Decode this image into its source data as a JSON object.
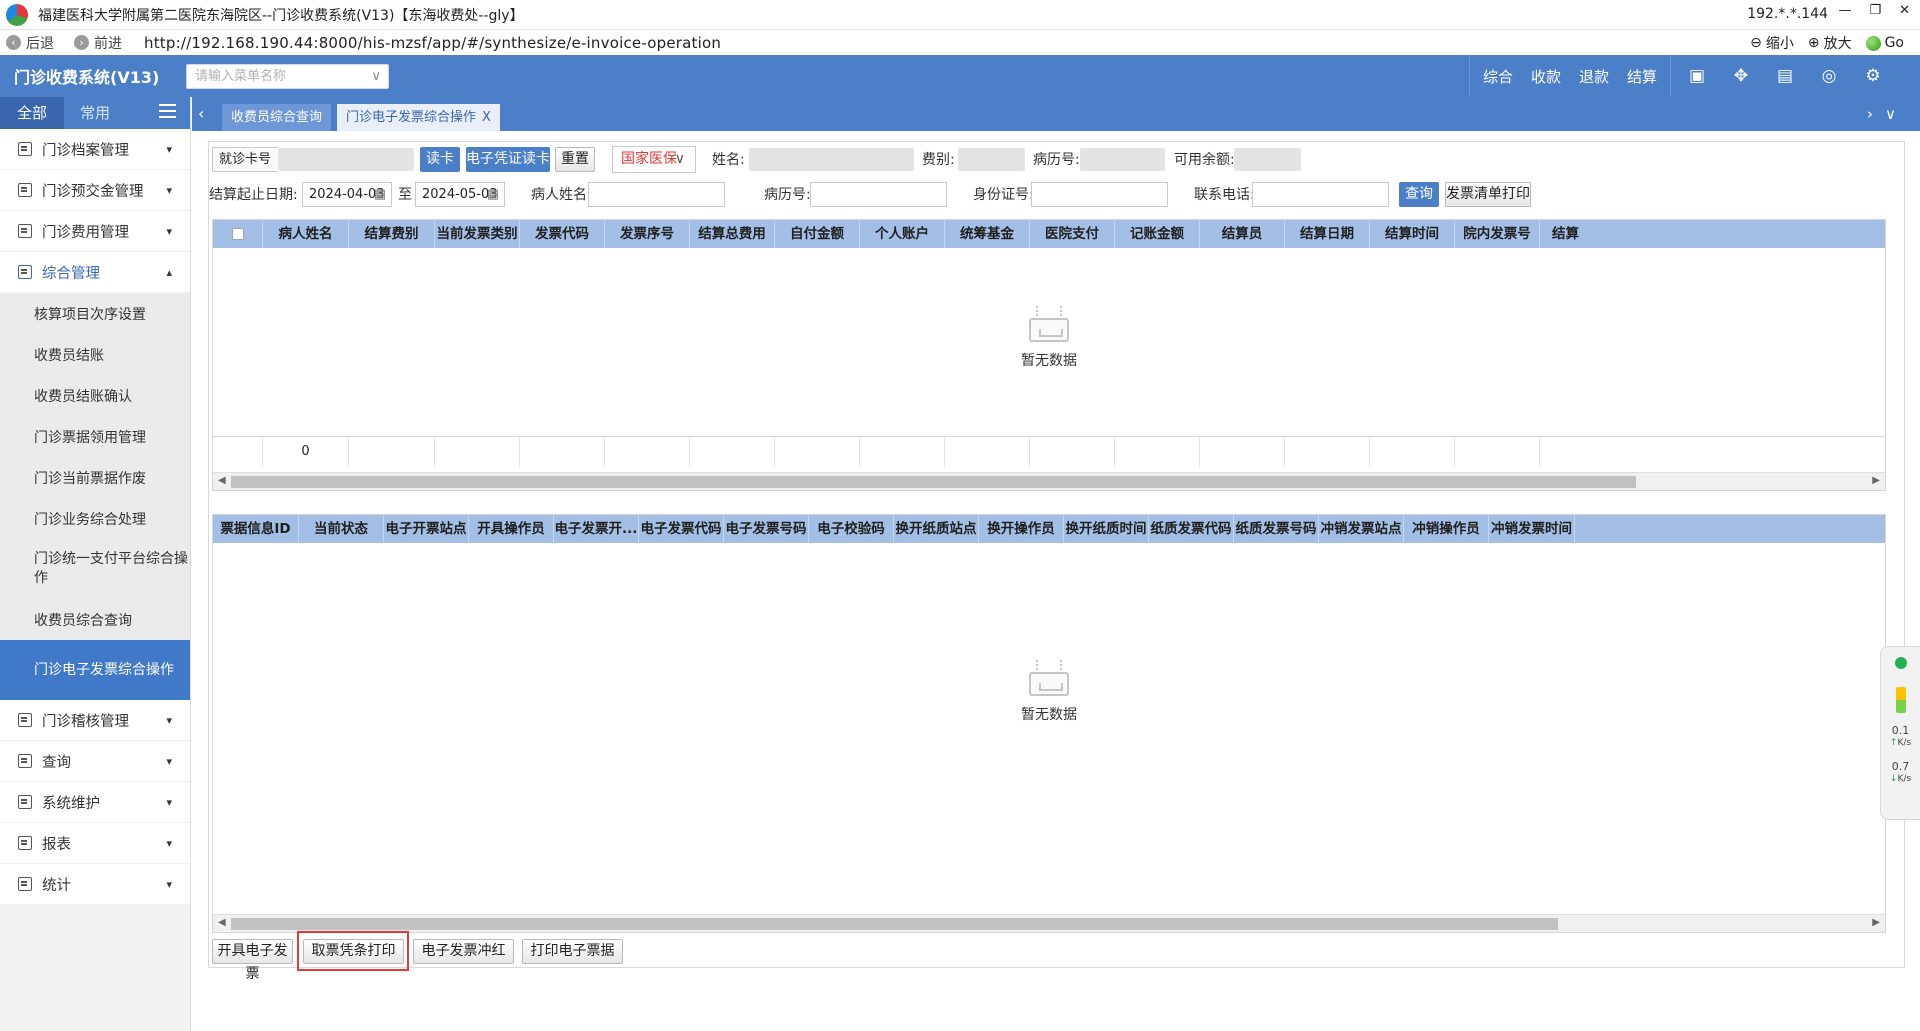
{
  "window": {
    "title": "福建医科大学附属第二医院东海院区--门诊收费系统(V13)【东海收费处--gly】",
    "ip": "192.*.*.144",
    "controls": [
      "—",
      "❐",
      "✕"
    ]
  },
  "addressbar": {
    "back": "后退",
    "forward": "前进",
    "url": "http://192.168.190.44:8000/his-mzsf/app/#/synthesize/e-invoice-operation",
    "zoom_out": "缩小",
    "zoom_in": "放大",
    "go": "Go"
  },
  "header": {
    "app_title": "门诊收费系统(V13)",
    "menu_search_placeholder": "请输入菜单名称",
    "nav": [
      "综合",
      "收款",
      "退款",
      "结算"
    ],
    "icons": [
      "screen-icon",
      "plugin-icon",
      "document-icon",
      "sync-icon",
      "settings-icon"
    ]
  },
  "sidebar": {
    "tabs": {
      "all": "全部",
      "common": "常用"
    },
    "groups_top": [
      {
        "label": "门诊档案管理"
      },
      {
        "label": "门诊预交金管理"
      },
      {
        "label": "门诊费用管理"
      }
    ],
    "open_group": {
      "label": "综合管理"
    },
    "subitems": [
      "核算项目次序设置",
      "收费员结账",
      "收费员结账确认",
      "门诊票据领用管理",
      "门诊当前票据作废",
      "门诊业务综合处理",
      "门诊统一支付平台综合操作",
      "收费员综合查询",
      "门诊电子发票综合操作"
    ],
    "groups_bottom": [
      {
        "label": "门诊稽核管理"
      },
      {
        "label": "查询"
      },
      {
        "label": "系统维护"
      },
      {
        "label": "报表"
      },
      {
        "label": "统计"
      }
    ]
  },
  "pagetabs": [
    {
      "label": "收费员综合查询"
    },
    {
      "label": "门诊电子发票综合操作",
      "close": "X"
    }
  ],
  "form": {
    "card_label": "就诊卡号",
    "read_card": "读卡",
    "e_voucher_read": "电子凭证读卡",
    "reset": "重置",
    "insurance_select": "国家医保",
    "name_label": "姓名:",
    "fee_type_label": "费别:",
    "record_no_label": "病历号:",
    "balance_label": "可用余额:",
    "date_label": "结算起止日期:",
    "date_from": "2024-04-03",
    "date_to_label": "至",
    "date_to": "2024-05-03",
    "patient_name_label": "病人姓名:",
    "record_no2_label": "病历号:",
    "id_label": "身份证号:",
    "phone_label": "联系电话:",
    "query": "查询",
    "print_list": "发票清单打印"
  },
  "grid1": {
    "columns": [
      "病人姓名",
      "结算费别",
      "当前发票类别",
      "发票代码",
      "发票序号",
      "结算总费用",
      "自付金额",
      "个人账户",
      "统筹基金",
      "医院支付",
      "记账金额",
      "结算员",
      "结算日期",
      "结算时间",
      "院内发票号",
      "结算"
    ],
    "empty_text": "暂无数据",
    "summary_count": "0"
  },
  "grid2": {
    "columns": [
      "票据信息ID",
      "当前状态",
      "电子开票站点",
      "开具操作员",
      "电子发票开...",
      "电子发票代码",
      "电子发票号码",
      "电子校验码",
      "换开纸质站点",
      "换开操作员",
      "换开纸质时间",
      "纸质发票代码",
      "纸质发票号码",
      "冲销发票站点",
      "冲销操作员",
      "冲销发票时间"
    ],
    "empty_text": "暂无数据"
  },
  "actions": [
    "开具电子发票",
    "取票凭条打印",
    "电子发票冲红",
    "打印电子票据"
  ],
  "net_widget": {
    "up": "0.1",
    "up_unit": "K/s",
    "down": "0.7",
    "down_unit": "K/s"
  }
}
